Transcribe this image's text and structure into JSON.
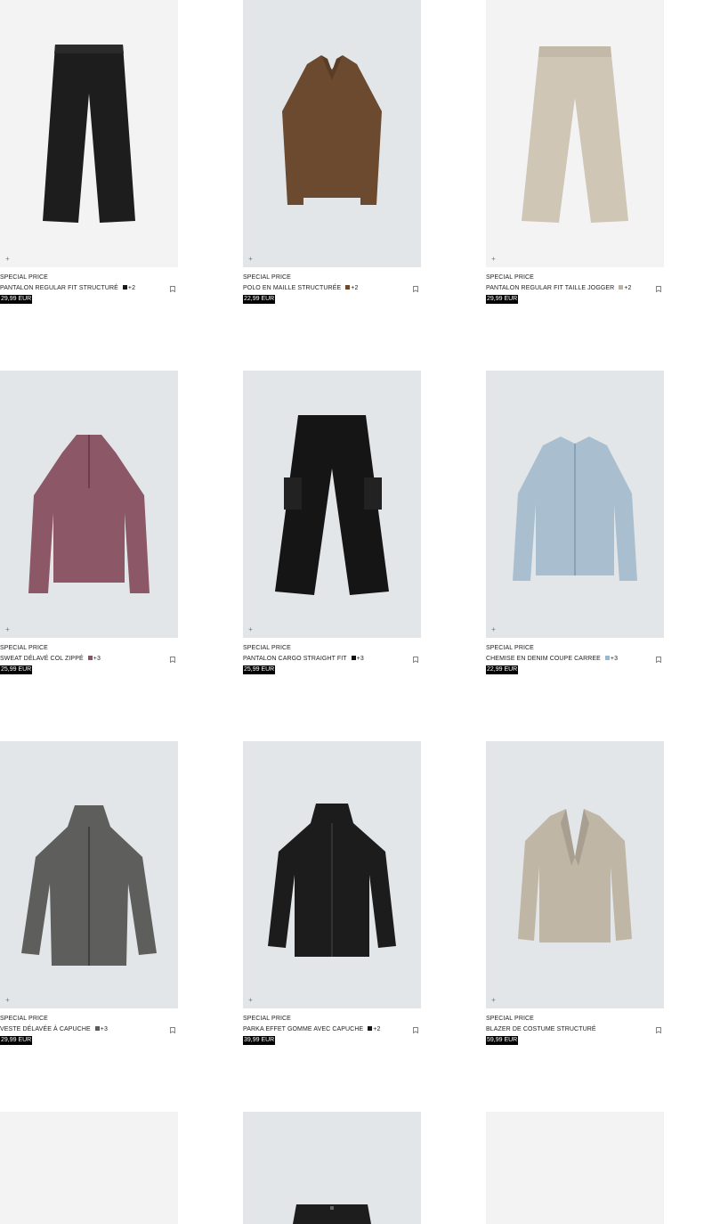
{
  "products": [
    {
      "tag": "SPECIAL PRICE",
      "name": "PANTALON REGULAR FIT STRUCTURÉ",
      "more": "+2",
      "price": "29,99 EUR",
      "swatch": "#1a1a1a",
      "icon": "black-trousers"
    },
    {
      "tag": "SPECIAL PRICE",
      "name": "POLO EN MAILLE STRUCTURÉE",
      "more": "+2",
      "price": "22,99 EUR",
      "swatch": "#6b4a30",
      "icon": "brown-knit-polo"
    },
    {
      "tag": "SPECIAL PRICE",
      "name": "PANTALON REGULAR FIT TAILLE JOGGER",
      "more": "+2",
      "price": "29,99 EUR",
      "swatch": "#bdb3a3",
      "icon": "beige-trousers"
    },
    {
      "tag": "SPECIAL PRICE",
      "name": "SWEAT DÉLAVÉ COL ZIPPÉ",
      "more": "+3",
      "price": "25,99 EUR",
      "swatch": "#8a5563",
      "icon": "mauve-zip-sweatshirt"
    },
    {
      "tag": "SPECIAL PRICE",
      "name": "PANTALON CARGO STRAIGHT FIT",
      "more": "+3",
      "price": "25,99 EUR",
      "swatch": "#111111",
      "icon": "black-cargo-trousers"
    },
    {
      "tag": "SPECIAL PRICE",
      "name": "CHEMISE EN DENIM COUPE CARREE",
      "more": "+3",
      "price": "22,99 EUR",
      "swatch": "#9fb6c6",
      "icon": "light-denim-shirt"
    },
    {
      "tag": "SPECIAL PRICE",
      "name": "VESTE DÉLAVÉE À CAPUCHE",
      "more": "+3",
      "price": "29,99 EUR",
      "swatch": "#5b5b5b",
      "icon": "grey-hooded-jacket"
    },
    {
      "tag": "SPECIAL PRICE",
      "name": "PARKA EFFET GOMME AVEC CAPUCHE",
      "more": "+2",
      "price": "39,99 EUR",
      "swatch": "#151515",
      "icon": "black-parka"
    },
    {
      "tag": "SPECIAL PRICE",
      "name": "BLAZER DE COSTUME STRUCTURÉ",
      "more": "",
      "price": "59,99 EUR",
      "swatch": "",
      "icon": "beige-blazer"
    }
  ],
  "plus_symbol": "+",
  "colors": {
    "price_bg": "#000000",
    "image_bg_grey": "#e3e6e8",
    "image_bg_light": "#f3f3f3"
  }
}
